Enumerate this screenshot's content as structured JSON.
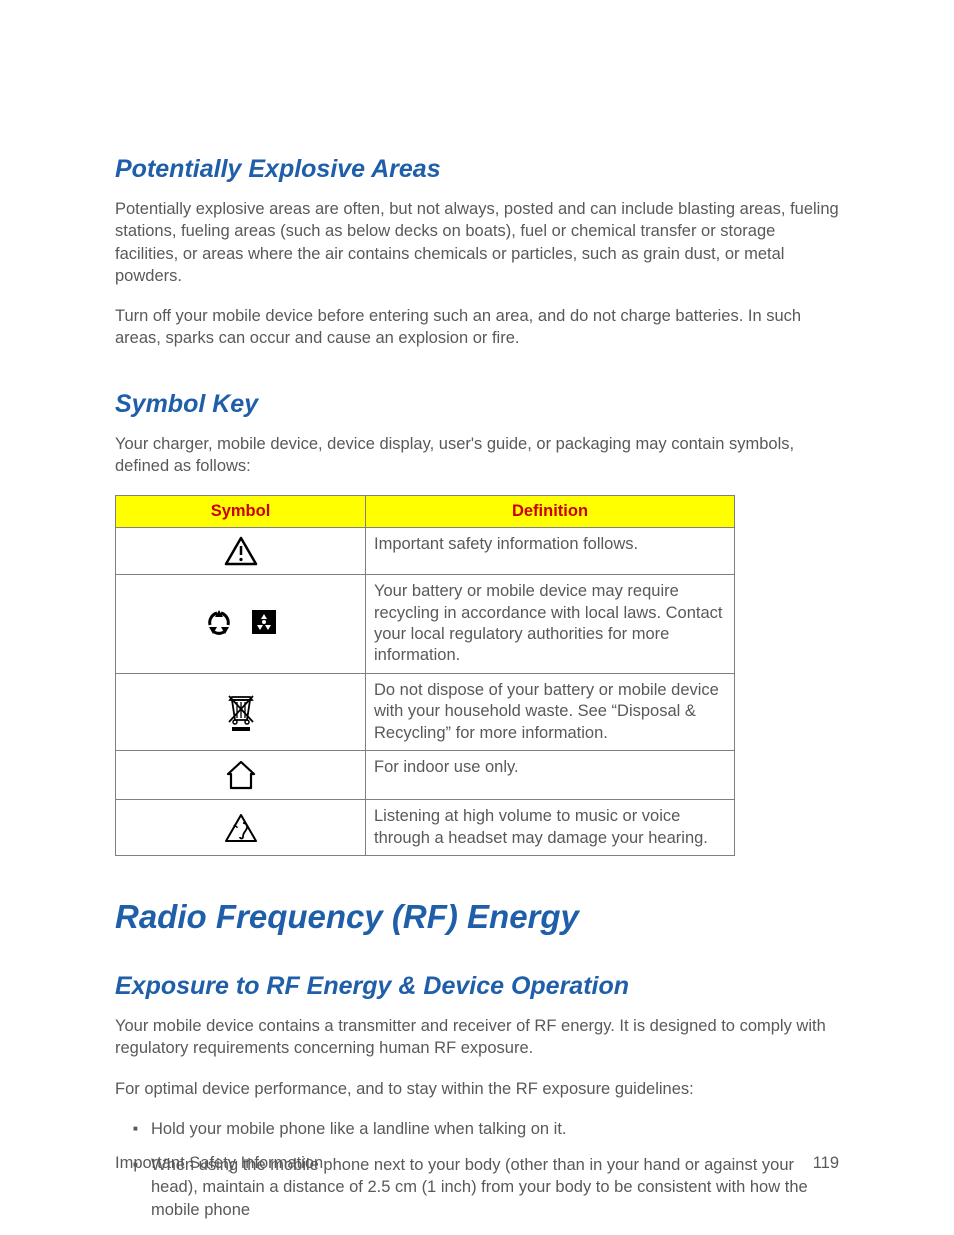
{
  "section1": {
    "heading": "Potentially Explosive Areas",
    "p1": "Potentially explosive areas are often, but not always, posted and can include blasting areas, fueling stations, fueling areas (such as below decks on boats), fuel or chemical transfer or storage facilities, or areas where the air contains chemicals or particles, such as grain dust, or metal powders.",
    "p2": "Turn off your mobile device before entering such an area, and do not charge batteries. In such areas, sparks can occur and cause an explosion or fire."
  },
  "section2": {
    "heading": "Symbol Key",
    "intro": "Your charger, mobile device, device display, user's guide, or packaging may contain symbols, defined as follows:",
    "table": {
      "headers": {
        "symbol": "Symbol",
        "definition": "Definition"
      },
      "rows": [
        {
          "icon": "warning-triangle",
          "def": "Important safety information follows."
        },
        {
          "icon": "recycle-group",
          "def": "Your battery or mobile device may require recycling in accordance with local laws. Contact your local regulatory authorities for more information."
        },
        {
          "icon": "crossed-bin",
          "def": "Do not dispose of your battery or mobile device with your household waste. See “Disposal & Recycling” for more information."
        },
        {
          "icon": "house",
          "def": "For indoor use only."
        },
        {
          "icon": "hearing",
          "def": "Listening at high volume to music or voice through a headset may damage your hearing."
        }
      ]
    }
  },
  "section3": {
    "heading": "Radio Frequency (RF) Energy"
  },
  "section4": {
    "heading": "Exposure to RF Energy & Device Operation",
    "p1": "Your mobile device contains a transmitter and receiver of RF energy. It is designed to comply with regulatory requirements concerning human RF exposure.",
    "p2": "For optimal device performance, and to stay within the RF exposure guidelines:",
    "bullets": [
      "Hold your mobile phone like a landline when talking on it.",
      "When using the mobile phone next to your body (other than in your hand or against your head), maintain a distance of 2.5 cm (1 inch) from your body to be consistent with how the mobile phone"
    ]
  },
  "footer": {
    "left": "Important Safety Information",
    "right": "119"
  }
}
